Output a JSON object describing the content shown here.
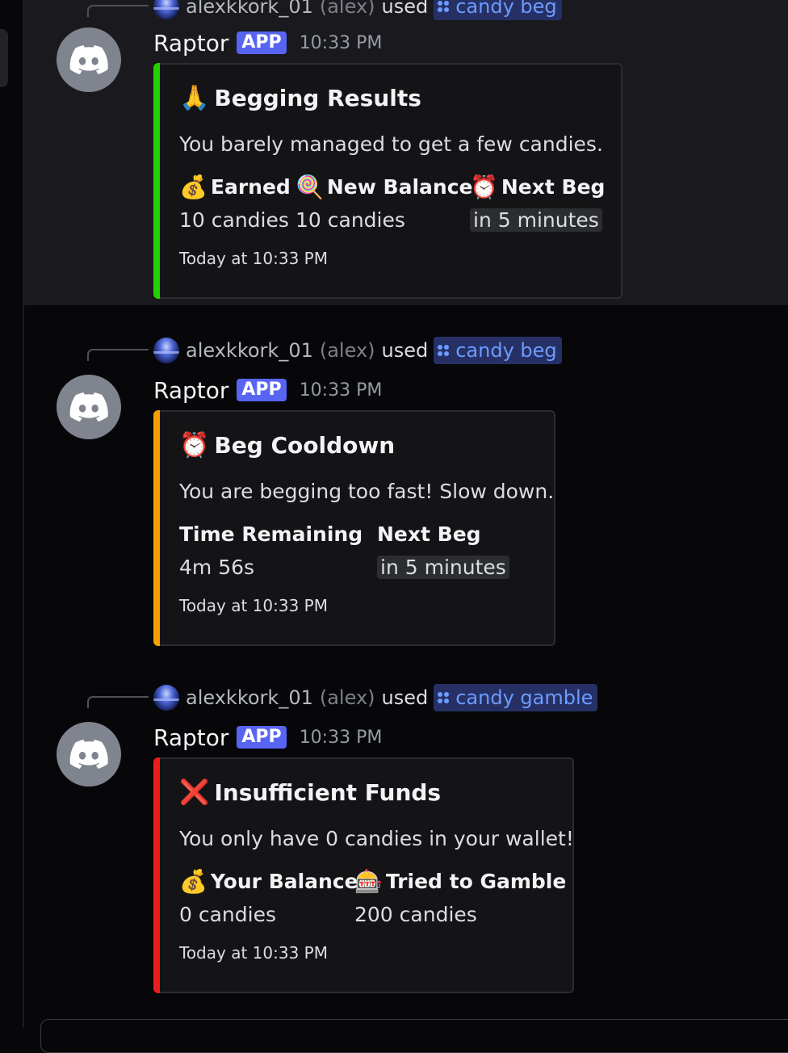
{
  "messages": [
    {
      "reply": {
        "user": "alexkkork_01",
        "handle": "(alex)",
        "used": "used",
        "command": "candy beg"
      },
      "bot": {
        "name": "Raptor",
        "badge": "APP",
        "time": "10:33 PM"
      },
      "embed": {
        "accent": "#23d100",
        "title_emoji": "🙏",
        "title": "Begging Results",
        "description": "You barely managed to get a few candies.",
        "fields": [
          {
            "emoji": "💰",
            "name": "Earned",
            "value": "10 candies",
            "code": false
          },
          {
            "emoji": "🍭",
            "name": "New Balance",
            "value": "10 candies",
            "code": false
          },
          {
            "emoji": "⏰",
            "name": "Next Beg",
            "value": "in 5 minutes",
            "code": true
          }
        ],
        "footer": "Today at 10:33 PM"
      }
    },
    {
      "reply": {
        "user": "alexkkork_01",
        "handle": "(alex)",
        "used": "used",
        "command": "candy beg"
      },
      "bot": {
        "name": "Raptor",
        "badge": "APP",
        "time": "10:33 PM"
      },
      "embed": {
        "accent": "#f5a000",
        "title_emoji": "⏰",
        "title": "Beg Cooldown",
        "description": "You are begging too fast! Slow down.",
        "fields": [
          {
            "emoji": "",
            "name": "Time Remaining",
            "value": "4m 56s",
            "code": false
          },
          {
            "emoji": "",
            "name": "Next Beg",
            "value": "in 5 minutes",
            "code": true
          }
        ],
        "footer": "Today at 10:33 PM"
      }
    },
    {
      "reply": {
        "user": "alexkkork_01",
        "handle": "(alex)",
        "used": "used",
        "command": "candy gamble"
      },
      "bot": {
        "name": "Raptor",
        "badge": "APP",
        "time": "10:33 PM"
      },
      "embed": {
        "accent": "#ed1d1d",
        "title_emoji": "❌",
        "title": "Insufficient Funds",
        "description": "You only have 0 candies in your wallet!",
        "fields": [
          {
            "emoji": "💰",
            "name": "Your Balance",
            "value": "0 candies",
            "code": false
          },
          {
            "emoji": "🎰",
            "name": "Tried to Gamble",
            "value": "200 candies",
            "code": false
          }
        ],
        "footer": "Today at 10:33 PM"
      }
    }
  ]
}
